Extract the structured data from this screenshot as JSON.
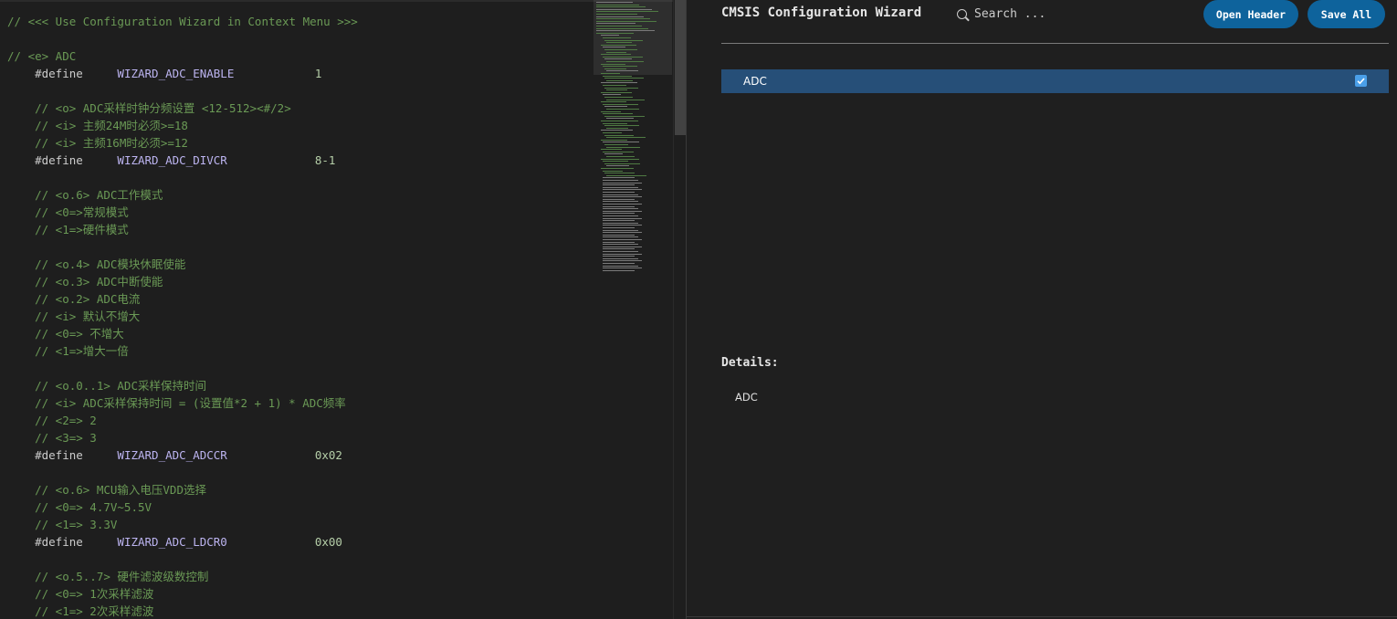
{
  "editor": {
    "lines": [
      {
        "type": "comment",
        "indent": 0,
        "text": "// <<< Use Configuration Wizard in Context Menu >>>"
      },
      {
        "type": "blank"
      },
      {
        "type": "comment",
        "indent": 0,
        "text": "// <e> ADC"
      },
      {
        "type": "define",
        "indent": 1,
        "keyword": "#define",
        "macro": "WIZARD_ADC_ENABLE",
        "value": "1"
      },
      {
        "type": "blank"
      },
      {
        "type": "comment",
        "indent": 1,
        "text": "// <o> ADC采样时钟分频设置 <12-512><#/2>"
      },
      {
        "type": "comment",
        "indent": 1,
        "text": "// <i> 主频24M时必须>=18"
      },
      {
        "type": "comment",
        "indent": 1,
        "text": "// <i> 主频16M时必须>=12"
      },
      {
        "type": "define",
        "indent": 1,
        "keyword": "#define",
        "macro": "WIZARD_ADC_DIVCR",
        "value": "8-1"
      },
      {
        "type": "blank"
      },
      {
        "type": "comment",
        "indent": 1,
        "text": "// <o.6> ADC工作模式"
      },
      {
        "type": "comment",
        "indent": 1,
        "text": "// <0=>常规模式"
      },
      {
        "type": "comment",
        "indent": 1,
        "text": "// <1=>硬件模式"
      },
      {
        "type": "blank"
      },
      {
        "type": "comment",
        "indent": 1,
        "text": "// <o.4> ADC模块休眠使能"
      },
      {
        "type": "comment",
        "indent": 1,
        "text": "// <o.3> ADC中断使能"
      },
      {
        "type": "comment",
        "indent": 1,
        "text": "// <o.2> ADC电流"
      },
      {
        "type": "comment",
        "indent": 1,
        "text": "// <i> 默认不增大"
      },
      {
        "type": "comment",
        "indent": 1,
        "text": "// <0=> 不增大"
      },
      {
        "type": "comment",
        "indent": 1,
        "text": "// <1=>增大一倍"
      },
      {
        "type": "blank"
      },
      {
        "type": "comment",
        "indent": 1,
        "text": "// <o.0..1> ADC采样保持时间"
      },
      {
        "type": "comment",
        "indent": 1,
        "text": "// <i> ADC采样保持时间 = (设置值*2 + 1) * ADC频率"
      },
      {
        "type": "comment",
        "indent": 1,
        "text": "// <2=> 2"
      },
      {
        "type": "comment",
        "indent": 1,
        "text": "// <3=> 3"
      },
      {
        "type": "define",
        "indent": 1,
        "keyword": "#define",
        "macro": "WIZARD_ADC_ADCCR",
        "value": "0x02"
      },
      {
        "type": "blank"
      },
      {
        "type": "comment",
        "indent": 1,
        "text": "// <o.6> MCU输入电压VDD选择"
      },
      {
        "type": "comment",
        "indent": 1,
        "text": "// <0=> 4.7V~5.5V"
      },
      {
        "type": "comment",
        "indent": 1,
        "text": "// <1=> 3.3V"
      },
      {
        "type": "define",
        "indent": 1,
        "keyword": "#define",
        "macro": "WIZARD_ADC_LDCR0",
        "value": "0x00"
      },
      {
        "type": "blank"
      },
      {
        "type": "comment",
        "indent": 1,
        "text": "// <o.5..7> 硬件滤波级数控制"
      },
      {
        "type": "comment",
        "indent": 1,
        "text": "// <0=> 1次采样滤波"
      },
      {
        "type": "comment",
        "indent": 1,
        "text": "// <1=> 2次采样滤波"
      }
    ]
  },
  "wizard": {
    "title": "CMSIS Configuration Wizard",
    "search_placeholder": "Search ...",
    "open_header_label": "Open Header",
    "save_all_label": "Save All",
    "tree": [
      {
        "label": "ADC",
        "checked": true,
        "selected": true
      }
    ],
    "details_title": "Details:",
    "details_text": "ADC"
  },
  "colors": {
    "accent": "#0e639c",
    "selection": "#264f78",
    "comment": "#6a9955",
    "number": "#b5cea8",
    "checkbox": "#4a9fe8"
  },
  "icons": {
    "search": "search-icon",
    "checkbox": "checkbox-checked-icon"
  }
}
